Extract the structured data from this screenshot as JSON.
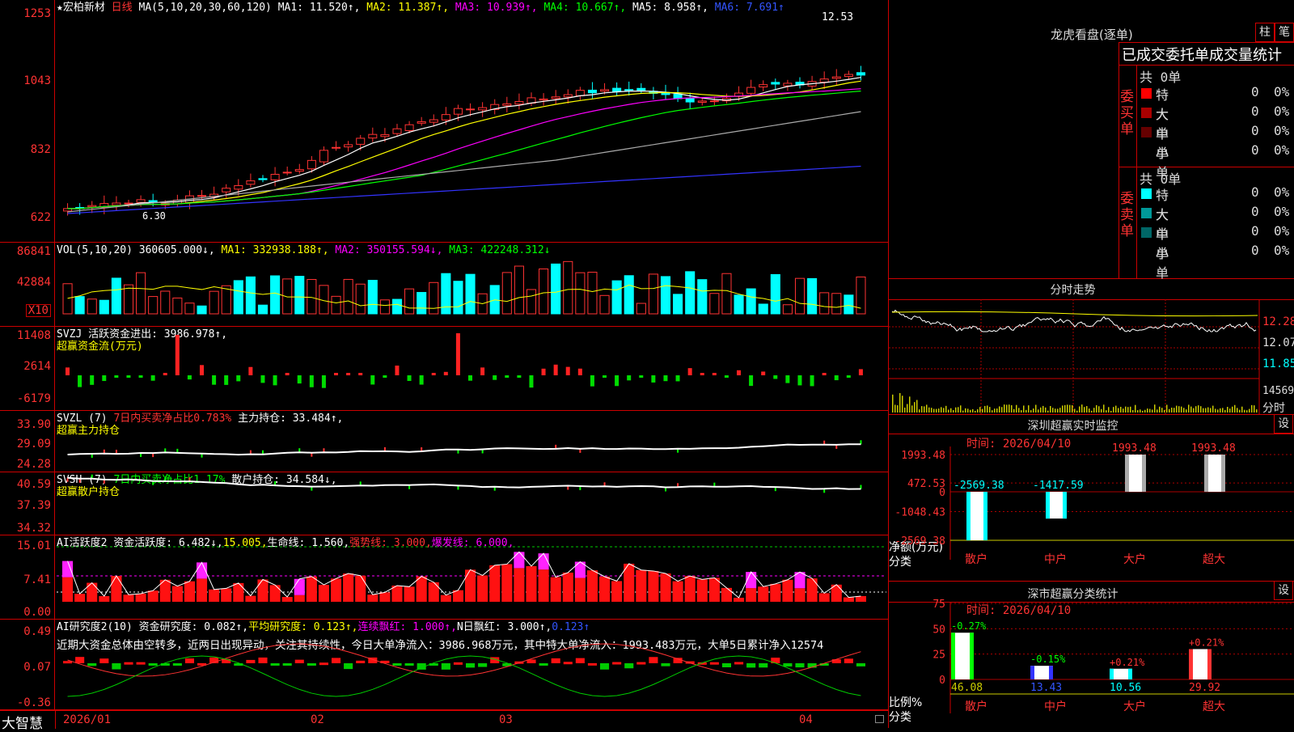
{
  "stock": {
    "name": "宏柏新材",
    "period": "日线",
    "ma_label": "MA(5,10,20,30,60,120)",
    "ma1": "MA1: 11.520↑,",
    "ma2": "MA2: 11.387↑,",
    "ma3": "MA3: 10.939↑,",
    "ma4": "MA4: 10.667↑,",
    "ma5": "MA5: 8.958↑,",
    "ma6": "MA6: 7.691↑",
    "high_note": "12.53",
    "low_note": "6.30"
  },
  "price_axis": [
    "1253",
    "1043",
    "832",
    "622"
  ],
  "vol_panel": {
    "title": "VOL(5,10,20)",
    "v": "360605.000↓,",
    "ma1": "MA1: 332938.188↑,",
    "ma2": "MA2: 350155.594↓,",
    "ma3": "MA3: 422248.312↓",
    "axis": [
      "86841",
      "42884"
    ],
    "unit": "X10"
  },
  "svzj_panel": {
    "title": "SVZJ  活跃资金进出: 3986.978↑,",
    "sub": "超赢资金流(万元)",
    "axis": [
      "11408",
      "2614",
      "-6179"
    ]
  },
  "svzl_panel": {
    "title_a": "SVZL (7) ",
    "title_b": "7日内买卖净占比0.783%",
    "title_c": " 主力持仓: 33.484↑,",
    "sub": "超赢主力持仓",
    "axis": [
      "33.90",
      "29.09",
      "24.28"
    ]
  },
  "svsh_panel": {
    "title_a": "SVSH (7) ",
    "title_b": "7日内买卖净占比1.17%",
    "title_c": " 散户持仓: 34.584↓,",
    "sub": "超赢散户持仓",
    "axis": [
      "40.59",
      "37.39",
      "34.32"
    ]
  },
  "ai_panel": {
    "t1": "AI活跃度2 资金活跃度: 6.482↓,",
    "t2": "15.005,",
    "t3": "生命线: 1.560,",
    "t4": "强势线: 3.000,",
    "t5": "爆发线: 6.000,",
    "axis": [
      "15.01",
      "7.41",
      "0.00"
    ]
  },
  "ai2_panel": {
    "t1": "AI研究度2(10) 资金研究度: 0.082↑,",
    "t2": "平均研究度: 0.123↑,",
    "t3": "连续飘红: 1.000↑,",
    "t4": "N日飘红: 3.000↑,",
    "t5": "0.123↑",
    "desc": "近期大资金总体由空转多，近两日出现异动，关注其持续性，今日大单净流入：3986.968万元，其中特大单净流入：1993.483万元，大单5日累计净入12574",
    "axis": [
      "0.49",
      "0.07",
      "-0.36"
    ]
  },
  "bottom": {
    "brand": "大智慧",
    "dates": [
      "2026/01",
      "02",
      "03",
      "04"
    ]
  },
  "lhb": {
    "title": "龙虎看盘(逐单)",
    "btn_zhu": "柱",
    "btn_bi": "笔",
    "header": "已成交委托单成交量统计",
    "buy_label": "委买单",
    "sell_label": "委卖单",
    "buy_total": "共 0单",
    "sell_total": "共 0单",
    "rows": [
      {
        "name": "特大",
        "v": "0",
        "p": "0%"
      },
      {
        "name": "大单",
        "v": "0",
        "p": "0%"
      },
      {
        "name": "中单",
        "v": "0",
        "p": "0%"
      },
      {
        "name": "小单",
        "v": "0",
        "p": "0%"
      }
    ],
    "buy_colors": [
      "#ff0000",
      "#aa0000",
      "#660000"
    ],
    "sell_colors": [
      "#00ffff",
      "#009999",
      "#006666"
    ]
  },
  "fenshi": {
    "title": "分时走势",
    "axis": [
      "12.28",
      "12.07",
      "11.85",
      "14569"
    ],
    "unit": "分时"
  },
  "monitor": {
    "title": "深圳超赢实时监控",
    "btn": "设",
    "time": "时间: 2026/04/10",
    "axis": [
      "1993.48",
      "472.53",
      "0",
      "-1048.43",
      "-2569.38"
    ],
    "ylabel": "净额(万元)",
    "xlabel": "分类",
    "categories": [
      "散户",
      "中户",
      "大户",
      "超大"
    ],
    "values": [
      -2569.38,
      -1417.59,
      1993.48,
      1993.48
    ],
    "labels": [
      "-2569.38",
      "-1417.59",
      "1993.48",
      "1993.48"
    ]
  },
  "classify": {
    "title": "深市超赢分类统计",
    "btn": "设",
    "time": "时间: 2026/04/10",
    "axis": [
      "75",
      "50",
      "25",
      "0"
    ],
    "ylabel": "比例%",
    "xlabel": "分类",
    "categories": [
      "散户",
      "中户",
      "大户",
      "超大"
    ],
    "values": [
      46.08,
      13.43,
      10.56,
      29.92
    ],
    "labels": [
      "46.08",
      "13.43",
      "10.56",
      "29.92"
    ],
    "changes": [
      "-0.27%",
      "-0.15%",
      "+0.21%",
      "+0.21%"
    ]
  },
  "chart_data": {
    "type": "bar",
    "title": "深圳超赢实时监控",
    "categories": [
      "散户",
      "中户",
      "大户",
      "超大"
    ],
    "values": [
      -2569.38,
      -1417.59,
      1993.48,
      1993.48
    ],
    "ylabel": "净额(万元)",
    "ylim": [
      -2569.38,
      1993.48
    ]
  }
}
